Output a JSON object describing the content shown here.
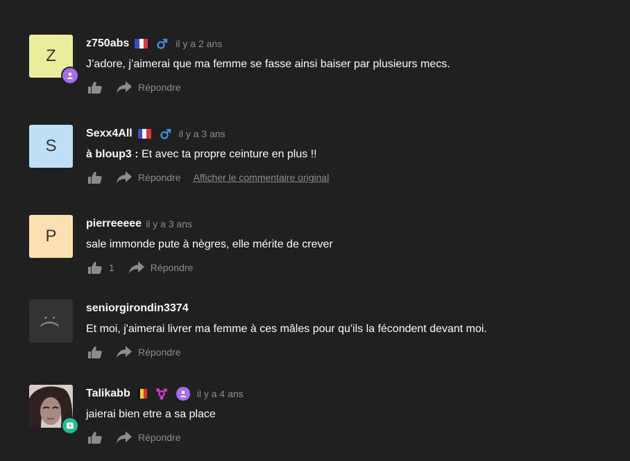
{
  "comments": [
    {
      "avatar_letter": "Z",
      "avatar_color": "#e9ef9c",
      "username": "z750abs",
      "flag": "france",
      "gender": "male",
      "time": "il y a 2 ans",
      "text": "J’adore, j’aimerai que ma femme se fasse ainsi baiser par plusieurs mecs.",
      "reply_label": "Répondre"
    },
    {
      "avatar_letter": "S",
      "avatar_color": "#bfdff7",
      "username": "Sexx4All",
      "flag": "france",
      "gender": "male",
      "time": "il y a 3 ans",
      "mention": "à bloup3 :",
      "text": " Et avec ta propre ceinture en plus !!",
      "reply_label": "Répondre",
      "original_link": "Afficher le commentaire original"
    },
    {
      "avatar_letter": "P",
      "avatar_color": "#fde0b2",
      "username": "pierreeeee",
      "time": "il y a 3 ans",
      "text": "sale immonde pute à nègres, elle mérite de crever",
      "likes": "1",
      "reply_label": "Répondre"
    },
    {
      "avatar_face": ":(",
      "username": "seniorgirondin3374",
      "text": "Et moi, j'aimerai livrer ma femme à ces mâles pour qu'ils la fécondent devant moi.",
      "reply_label": "Répondre"
    },
    {
      "username": "Talikabb",
      "flag": "belgium",
      "gender": "transgender",
      "time": "il y a 4 ans",
      "text": "jaierai bien etre a sa place",
      "reply_label": "Répondre"
    }
  ],
  "colors": {
    "background": "#202020",
    "muted": "#8c8c8c",
    "badge_purple": "#a56cf0",
    "badge_green": "#1fbf8f",
    "male_blue": "#3d8fe0",
    "trans_pink": "#e23ad8"
  }
}
